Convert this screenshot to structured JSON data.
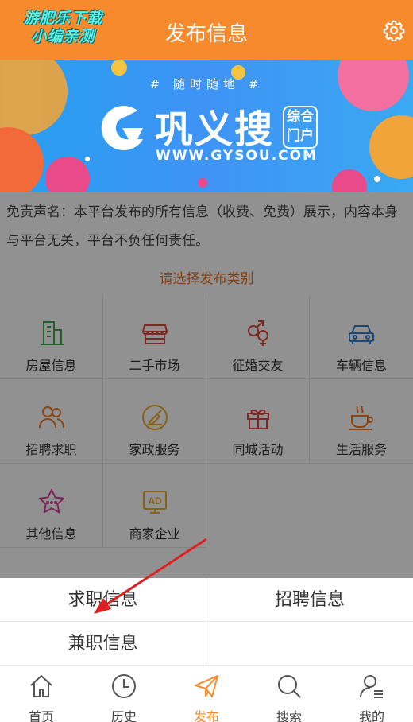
{
  "header": {
    "title": "发布信息",
    "watermark_line1": "游肥乐下载",
    "watermark_line2": "小编亲测",
    "settings_icon": "gear-icon",
    "bg_color": "#f68a2c"
  },
  "banner": {
    "tagline": "# 随时随地 #",
    "brand": "巩义搜",
    "side_tag_line1": "综合",
    "side_tag_line2": "门户",
    "url": "WWW.GYSOU.COM"
  },
  "disclaimer": "免责声名：本平台发布的所有信息（收费、免费）展示，内容本身与平台无关，平台不负任何责任。",
  "choose_category": "请选择发布类别",
  "categories": [
    {
      "label": "房屋信息",
      "icon": "building-icon",
      "color": "#3aa84a"
    },
    {
      "label": "二手市场",
      "icon": "shop-icon",
      "color": "#e0453c"
    },
    {
      "label": "征婚交友",
      "icon": "gender-icon",
      "color": "#e0453c"
    },
    {
      "label": "车辆信息",
      "icon": "car-icon",
      "color": "#2f7fd4"
    },
    {
      "label": "招聘求职",
      "icon": "people-icon",
      "color": "#f07c2a"
    },
    {
      "label": "家政服务",
      "icon": "cleaning-icon",
      "color": "#f0a92a"
    },
    {
      "label": "同城活动",
      "icon": "gift-icon",
      "color": "#e0453c"
    },
    {
      "label": "生活服务",
      "icon": "coffee-icon",
      "color": "#f07c2a"
    },
    {
      "label": "其他信息",
      "icon": "star-icon",
      "color": "#d9409a"
    },
    {
      "label": "商家企业",
      "icon": "ad-icon",
      "color": "#f0a92a"
    }
  ],
  "sheet_options": [
    "求职信息",
    "招聘信息",
    "兼职信息"
  ],
  "tabs": [
    {
      "label": "首页",
      "icon": "home-icon",
      "active": false
    },
    {
      "label": "历史",
      "icon": "clock-icon",
      "active": false
    },
    {
      "label": "发布",
      "icon": "send-icon",
      "active": true
    },
    {
      "label": "搜索",
      "icon": "search-icon",
      "active": false
    },
    {
      "label": "我的",
      "icon": "user-icon",
      "active": false
    }
  ],
  "accent_color": "#f68a2c",
  "annotation_color": "#e02020"
}
